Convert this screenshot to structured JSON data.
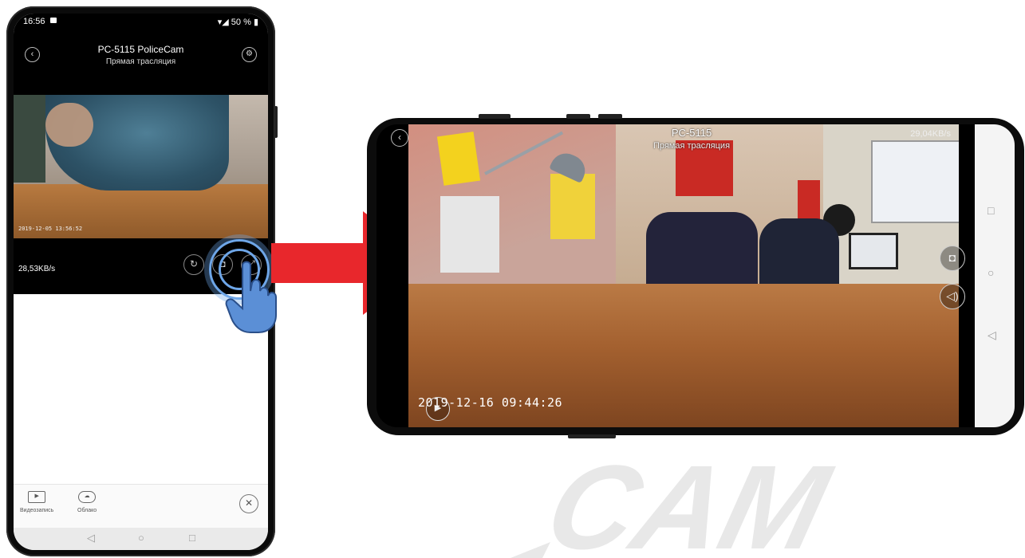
{
  "portrait": {
    "status": {
      "time": "16:56",
      "battery": "50 %"
    },
    "header": {
      "title": "PC-5115 PoliceCam",
      "subtitle": "Прямая трасляция"
    },
    "video": {
      "timestamp": "2019-12-05 13:56:52"
    },
    "bitrate": "28,53KB/s",
    "toolbar": [
      {
        "label": "Видеозапись",
        "icon": "video-record-icon"
      },
      {
        "label": "Облако",
        "icon": "cloud-icon"
      }
    ]
  },
  "landscape": {
    "title": "PC-5115",
    "subtitle": "Прямая трасляция",
    "bitrate": "29,04KB/s",
    "timestamp": "2019-12-16 09:44:26"
  },
  "watermark": {
    "text": "CAM"
  },
  "colors": {
    "arrow": "#e8272c",
    "ring": "#6ea6e8",
    "watermark": "#e8e8e8"
  }
}
